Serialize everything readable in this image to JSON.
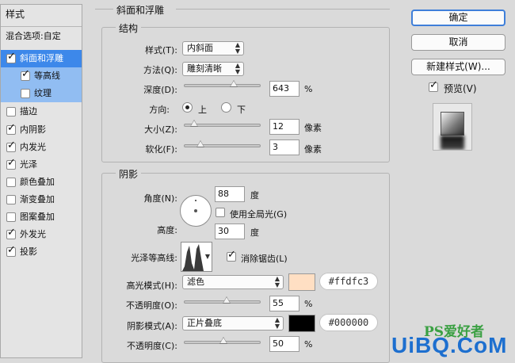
{
  "styles_panel": {
    "header": "样式",
    "blend_options": "混合选项:自定",
    "items": [
      {
        "label": "斜面和浮雕",
        "checked": true
      },
      {
        "label": "等高线",
        "checked": true
      },
      {
        "label": "纹理",
        "checked": false
      },
      {
        "label": "描边",
        "checked": false
      },
      {
        "label": "内阴影",
        "checked": true
      },
      {
        "label": "内发光",
        "checked": true
      },
      {
        "label": "光泽",
        "checked": true
      },
      {
        "label": "颜色叠加",
        "checked": false
      },
      {
        "label": "渐变叠加",
        "checked": false
      },
      {
        "label": "图案叠加",
        "checked": false
      },
      {
        "label": "外发光",
        "checked": true
      },
      {
        "label": "投影",
        "checked": true
      }
    ]
  },
  "bevel": {
    "section_title": "斜面和浮雕",
    "structure": {
      "title": "结构",
      "style_label": "样式(T):",
      "style_value": "内斜面",
      "technique_label": "方法(Q):",
      "technique_value": "雕刻清晰",
      "depth_label": "深度(D):",
      "depth_value": "643",
      "depth_unit": "%",
      "depth_level": 0.66,
      "direction_label": "方向:",
      "direction_up": "上",
      "direction_down": "下",
      "size_label": "大小(Z):",
      "size_value": "12",
      "size_unit": "像素",
      "size_level": 0.07,
      "soften_label": "软化(F):",
      "soften_value": "3",
      "soften_unit": "像素",
      "soften_level": 0.17
    },
    "shading": {
      "title": "阴影",
      "angle_label": "角度(N):",
      "angle_value": "88",
      "angle_unit": "度",
      "global_light_label": "使用全局光(G)",
      "altitude_label": "高度:",
      "altitude_value": "30",
      "altitude_unit": "度",
      "gloss_contour_label": "光泽等高线:",
      "anti_aliased_label": "消除锯齿(L)",
      "highlight_mode_label": "高光模式(H):",
      "highlight_mode_value": "滤色",
      "highlight_color": "#ffdfc3",
      "highlight_color_text": "#ffdfc3",
      "highlight_opacity_label": "不透明度(O):",
      "highlight_opacity_value": "55",
      "highlight_opacity_unit": "%",
      "highlight_opacity_level": 0.55,
      "shadow_mode_label": "阴影模式(A):",
      "shadow_mode_value": "正片叠底",
      "shadow_color": "#000000",
      "shadow_color_text": "#000000",
      "shadow_opacity_label": "不透明度(C):",
      "shadow_opacity_value": "50",
      "shadow_opacity_unit": "%",
      "shadow_opacity_level": 0.5
    }
  },
  "buttons": {
    "ok": "确定",
    "cancel": "取消",
    "new_style": "新建样式(W)...",
    "preview": "预览(V)"
  },
  "watermark": {
    "site_cn": "PS爱好者",
    "site_en": "UiBQ.CoM"
  }
}
